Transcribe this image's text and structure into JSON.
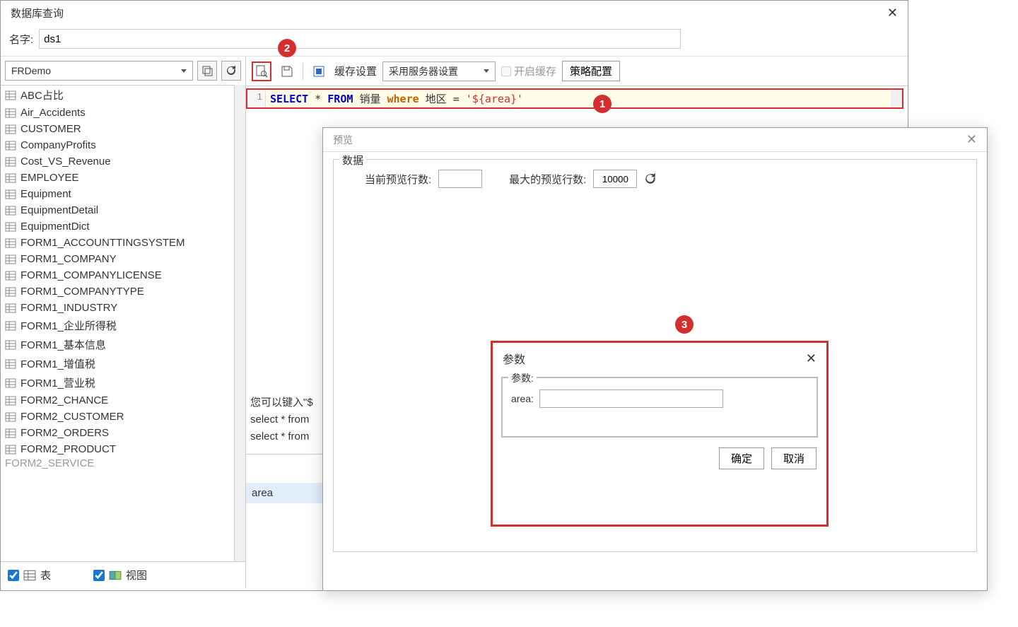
{
  "window": {
    "title": "数据库查询",
    "name_label": "名字:",
    "name_value": "ds1"
  },
  "db": {
    "selected": "FRDemo",
    "tables": [
      "ABC占比",
      "Air_Accidents",
      "CUSTOMER",
      "CompanyProfits",
      "Cost_VS_Revenue",
      "EMPLOYEE",
      "Equipment",
      "EquipmentDetail",
      "EquipmentDict",
      "FORM1_ACCOUNTTINGSYSTEM",
      "FORM1_COMPANY",
      "FORM1_COMPANYLICENSE",
      "FORM1_COMPANYTYPE",
      "FORM1_INDUSTRY",
      "FORM1_企业所得税",
      "FORM1_基本信息",
      "FORM1_增值税",
      "FORM1_营业税",
      "FORM2_CHANCE",
      "FORM2_CUSTOMER",
      "FORM2_ORDERS",
      "FORM2_PRODUCT"
    ],
    "tables_cut": "FORM2_SERVICE",
    "check_tables": "表",
    "check_views": "视图"
  },
  "toolbar": {
    "cache_label": "缓存设置",
    "cache_combo": "采用服务器设置",
    "enable_cache": "开启缓存",
    "strategy": "策略配置"
  },
  "sql": {
    "line_no": "1",
    "k_select": "SELECT",
    "k_star": "*",
    "k_from": "FROM",
    "tbl": "销量",
    "k_where": "where",
    "col": "地区",
    "eq": "=",
    "param": "'${area}'"
  },
  "hint": {
    "l1": "您可以键入\"$",
    "l2": "select * from",
    "l3": "select * from"
  },
  "param_list": {
    "area": "area"
  },
  "preview": {
    "title": "预览",
    "group_label": "数据",
    "cur_rows_label": "当前预览行数:",
    "cur_rows_value": "",
    "max_rows_label": "最大的预览行数:",
    "max_rows_value": "10000"
  },
  "params_dialog": {
    "title": "参数",
    "group_label": "参数:",
    "param_name": "area:",
    "param_value": "",
    "ok": "确定",
    "cancel": "取消"
  },
  "badges": {
    "b1": "1",
    "b2": "2",
    "b3": "3"
  }
}
